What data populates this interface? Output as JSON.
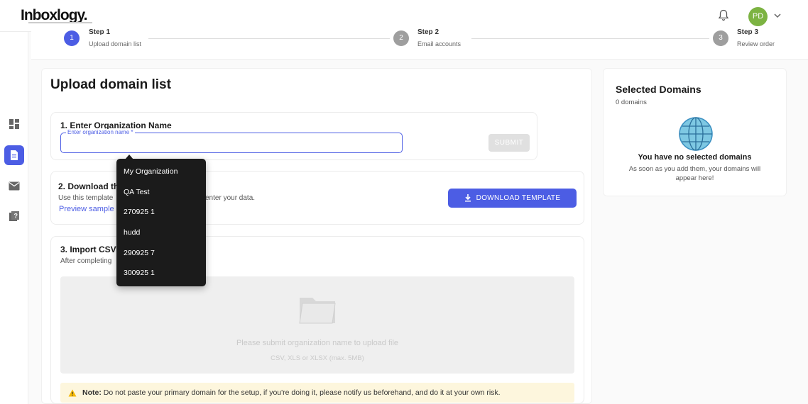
{
  "header": {
    "logo": "Inboxlogy.",
    "avatar_initials": "PD",
    "icons": [
      "bell-icon",
      "chevron-down-icon"
    ]
  },
  "sidebar": {
    "items": [
      {
        "icon": "dashboard-icon",
        "active": false
      },
      {
        "icon": "document-icon",
        "active": true
      },
      {
        "icon": "mail-icon",
        "active": false
      },
      {
        "icon": "help-book-icon",
        "active": false
      }
    ]
  },
  "stepper": {
    "steps": [
      {
        "num": "1",
        "title": "Step 1",
        "sub": "Upload domain list"
      },
      {
        "num": "2",
        "title": "Step 2",
        "sub": "Email accounts"
      },
      {
        "num": "3",
        "title": "Step 3",
        "sub": "Review order"
      }
    ]
  },
  "main": {
    "title": "Upload domain list",
    "section1": {
      "title": "1. Enter Organization Name",
      "input_label": "Enter organization name *",
      "submit_label": "SUBMIT"
    },
    "section2": {
      "title": "2. Download the",
      "text": "Use this template",
      "text_tail": "enter your data.",
      "preview_link": "Preview sample",
      "download_label": "DOWNLOAD TEMPLATE"
    },
    "section3": {
      "title": "3. Import CSV",
      "text": "After completing",
      "dropzone_text": "Please submit organization name to upload file",
      "dropzone_sub": "CSV, XLS or XLSX (max. 5MB)"
    },
    "note": {
      "bold": "Note:",
      "text": "Do not paste your primary domain for the setup, if you're doing it, please notify us beforehand, and do it at your own risk."
    }
  },
  "selected": {
    "title": "Selected Domains",
    "count": "0 domains",
    "empty_title": "You have no selected domains",
    "empty_desc": "As soon as you add them, your domains will appear here!"
  },
  "dropdown": {
    "options": [
      "My Organization",
      "QA Test",
      "270925 1",
      "hudd",
      "290925 7",
      "300925 1"
    ]
  },
  "colors": {
    "accent": "#4c5de4",
    "step_inactive": "#9e9e9e",
    "avatar": "#7cb342",
    "note_bg": "#fdf6dd"
  }
}
